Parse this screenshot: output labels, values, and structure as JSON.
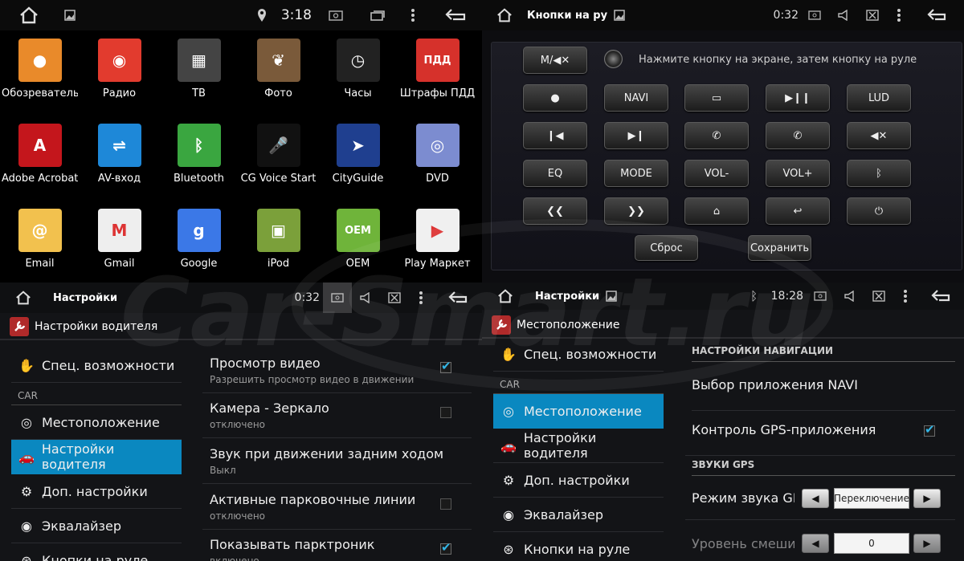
{
  "launcher": {
    "time": "3:18",
    "apps": [
      {
        "label": "Обозреватель",
        "icon": "file-manager-icon",
        "color": "#e98a2a",
        "glyph": "●"
      },
      {
        "label": "Радио",
        "icon": "radio-icon",
        "color": "#e23b2e",
        "glyph": "◉"
      },
      {
        "label": "ТВ",
        "icon": "tv-icon",
        "color": "#444",
        "glyph": "▦"
      },
      {
        "label": "Фото",
        "icon": "photo-icon",
        "color": "#7a5a3a",
        "glyph": "❦"
      },
      {
        "label": "Часы",
        "icon": "clock-icon",
        "color": "#222",
        "glyph": "◷"
      },
      {
        "label": "Штрафы ПДД",
        "icon": "traffic-fines-icon",
        "color": "#d6312b",
        "glyph": "ПДД"
      },
      {
        "label": "Adobe Acrobat",
        "icon": "adobe-acrobat-icon",
        "color": "#c4161c",
        "glyph": "A"
      },
      {
        "label": "AV-вход",
        "icon": "av-input-icon",
        "color": "#1e88d8",
        "glyph": "⇌"
      },
      {
        "label": "Bluetooth",
        "icon": "bluetooth-icon",
        "color": "#3aa640",
        "glyph": "ᛒ"
      },
      {
        "label": "CG Voice Start",
        "icon": "voice-car-icon",
        "color": "#111",
        "glyph": "🎤"
      },
      {
        "label": "CityGuide",
        "icon": "cityguide-icon",
        "color": "#1f3f8f",
        "glyph": "➤"
      },
      {
        "label": "DVD",
        "icon": "dvd-icon",
        "color": "#7c8cd0",
        "glyph": "◎"
      },
      {
        "label": "Email",
        "icon": "email-icon",
        "color": "#f2c14e",
        "glyph": "@"
      },
      {
        "label": "Gmail",
        "icon": "gmail-icon",
        "color": "#eeeeee",
        "glyph": "M"
      },
      {
        "label": "Google",
        "icon": "google-icon",
        "color": "#3b78e7",
        "glyph": "g"
      },
      {
        "label": "iPod",
        "icon": "ipod-icon",
        "color": "#7ba03a",
        "glyph": "▣"
      },
      {
        "label": "OEM",
        "icon": "oem-android-icon",
        "color": "#6fb43a",
        "glyph": "OEM"
      },
      {
        "label": "Play Маркет",
        "icon": "play-market-icon",
        "color": "#f0f0f0",
        "glyph": "▶"
      }
    ]
  },
  "steering": {
    "title": "Кнопки на ру",
    "time": "0:32",
    "hint": "Нажмите кнопку на экране, затем кнопку на руле",
    "mute_mode_label": "M/◀✕",
    "buttons": [
      {
        "label": "●",
        "name": "disc-button"
      },
      {
        "label": "NAVI",
        "name": "navi-button"
      },
      {
        "label": "▭",
        "name": "radio-button"
      },
      {
        "label": "▶❙❙",
        "name": "play-pause-button"
      },
      {
        "label": "LUD",
        "name": "lud-button"
      },
      {
        "label": "❙◀",
        "name": "prev-track-button"
      },
      {
        "label": "▶❙",
        "name": "next-track-button"
      },
      {
        "label": "✆",
        "name": "call-button"
      },
      {
        "label": "✆",
        "name": "hangup-button"
      },
      {
        "label": "◀✕",
        "name": "mute-button"
      },
      {
        "label": "EQ",
        "name": "eq-button"
      },
      {
        "label": "MODE",
        "name": "mode-button"
      },
      {
        "label": "VOL-",
        "name": "vol-down-button"
      },
      {
        "label": "VOL+",
        "name": "vol-up-button"
      },
      {
        "label": "ᛒ",
        "name": "bluetooth-button"
      },
      {
        "label": "❮❮",
        "name": "rewind-button"
      },
      {
        "label": "❯❯",
        "name": "fast-forward-button"
      },
      {
        "label": "⌂",
        "name": "home-button"
      },
      {
        "label": "↩",
        "name": "back-button"
      },
      {
        "label": "⏻",
        "name": "power-button"
      }
    ],
    "reset_label": "Сброс",
    "save_label": "Сохранить"
  },
  "driver": {
    "title": "Настройки",
    "time": "0:32",
    "section_title": "Настройки водителя",
    "sidebar": {
      "accessibility": "Спец. возможности",
      "category": "CAR",
      "items": [
        "Местоположение",
        "Настройки водителя",
        "Доп. настройки",
        "Эквалайзер",
        "Кнопки на руле"
      ]
    },
    "options": [
      {
        "title": "Просмотр видео",
        "sub": "Разрешить просмотр видео в движении",
        "checked": true
      },
      {
        "title": "Камера - Зеркало",
        "sub": "отключено",
        "checked": false
      },
      {
        "title": "Звук при движении задним ходом",
        "sub": "Выкл",
        "checked": null
      },
      {
        "title": "Активные парковочные линии",
        "sub": "отключено",
        "checked": false
      },
      {
        "title": "Показывать парктроник",
        "sub": "включено",
        "checked": true
      }
    ]
  },
  "location": {
    "title": "Настройки",
    "time": "18:28",
    "section_title": "Местоположение",
    "sidebar": {
      "accessibility": "Спец. возможности",
      "category": "CAR",
      "items": [
        "Местоположение",
        "Настройки водителя",
        "Доп. настройки",
        "Эквалайзер",
        "Кнопки на руле"
      ]
    },
    "nav_header": "НАСТРОЙКИ НАВИГАЦИИ",
    "navi_app": "Выбор приложения NAVI",
    "gps_control": "Контроль GPS-приложения",
    "gps_sounds_header": "ЗВУКИ GPS",
    "gps_sound_mode": "Режим звука GPS",
    "gps_sound_mode_value": "Переключение",
    "mix_level": "Уровень смешивания",
    "mix_level_value": "0"
  },
  "watermark": "Car-Smart.ru"
}
